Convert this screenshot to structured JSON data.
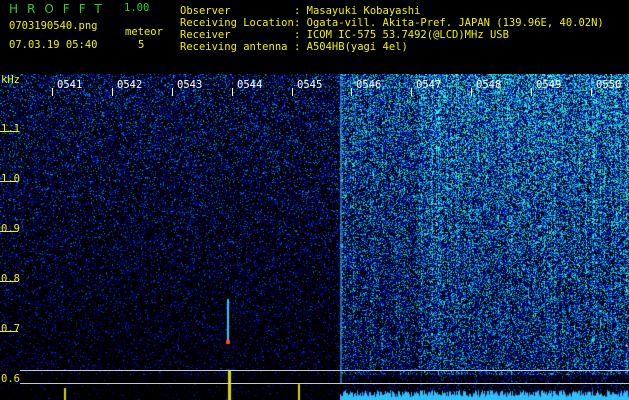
{
  "header": {
    "logo": "HROFFT",
    "version": "1.00",
    "filename": "0703190540.png",
    "datetime": "07.03.19 05:40",
    "meteor_label": "meteor",
    "meteor_count": "5"
  },
  "info": {
    "observer_label": "Observer",
    "observer_value": ": Masayuki Kobayashi",
    "location_label": "Receiving Location",
    "location_value": ": Ogata-vill. Akita-Pref. JAPAN (139.96E, 40.02N)",
    "receiver_label": "Receiver",
    "receiver_value": ": ICOM IC-575 53.7492(@LCD)MHz USB",
    "antenna_label": "Receiving antenna",
    "antenna_value": ": A504HB(yagi 4el)"
  },
  "yaxis": {
    "unit": "kHz",
    "labels": [
      "1.1",
      "1.0",
      "0.9",
      "0.8",
      "0.7",
      "0.6"
    ]
  },
  "time_labels": [
    "0541",
    "0542",
    "0543",
    "0544",
    "0545",
    "0546",
    "0547",
    "0548",
    "0549",
    "0550"
  ],
  "colors": {
    "header_green": "#2fd12f",
    "header_yellow": "#f2f200",
    "background": "#000000"
  }
}
